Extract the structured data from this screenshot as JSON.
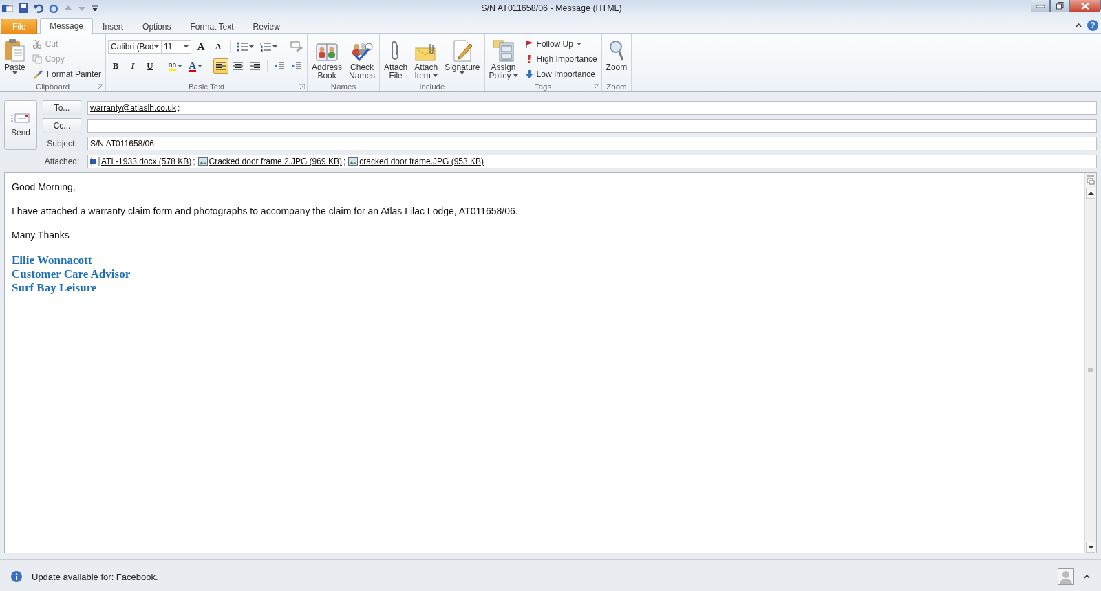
{
  "window": {
    "title": "S/N AT011658/06  -  Message (HTML)",
    "help_glyph": "?"
  },
  "tabs": [
    {
      "kind": "file",
      "label": "File",
      "selected": false
    },
    {
      "kind": "tab",
      "label": "Message",
      "selected": true
    },
    {
      "kind": "tab",
      "label": "Insert",
      "selected": false
    },
    {
      "kind": "tab",
      "label": "Options",
      "selected": false
    },
    {
      "kind": "tab",
      "label": "Format Text",
      "selected": false
    },
    {
      "kind": "tab",
      "label": "Review",
      "selected": false
    }
  ],
  "ribbon": {
    "groups": [
      {
        "kind": "clipboard",
        "label": "Clipboard",
        "launcher": true,
        "paste": {
          "label": "Paste"
        },
        "commands": [
          {
            "label": "Cut",
            "disabled": true
          },
          {
            "label": "Copy",
            "disabled": true
          },
          {
            "label": "Format Painter",
            "disabled": false
          }
        ]
      },
      {
        "kind": "basic_text",
        "label": "Basic Text",
        "launcher": true,
        "font": "Calibri (Bod",
        "size": "11",
        "grow": "A",
        "shrink": "A",
        "styles": [
          {
            "kind": "bold",
            "label": "B"
          },
          {
            "kind": "italic",
            "label": "I"
          },
          {
            "kind": "underline",
            "label": "U"
          }
        ],
        "highlight": "ab",
        "font_color": "A",
        "align": [
          {
            "kind": "left",
            "selected": true
          },
          {
            "kind": "center",
            "selected": false
          },
          {
            "kind": "right",
            "selected": false
          }
        ]
      },
      {
        "kind": "large",
        "label": "Names",
        "launcher": false,
        "buttons": [
          {
            "lines": [
              "Address",
              "Book"
            ],
            "caret": false
          },
          {
            "lines": [
              "Check",
              "Names"
            ],
            "caret": false
          }
        ]
      },
      {
        "kind": "large",
        "label": "Include",
        "launcher": false,
        "buttons": [
          {
            "lines": [
              "Attach",
              "File"
            ],
            "caret": false
          },
          {
            "lines": [
              "Attach",
              "Item"
            ],
            "caret": true
          },
          {
            "lines": [
              "Signature"
            ],
            "caret": true
          }
        ]
      },
      {
        "kind": "tags",
        "label": "Tags",
        "launcher": true,
        "policy": {
          "lines": [
            "Assign",
            "Policy"
          ],
          "caret": true
        },
        "commands": [
          {
            "label": "Follow Up",
            "caret": true
          },
          {
            "label": "High Importance",
            "caret": false
          },
          {
            "label": "Low Importance",
            "caret": false
          }
        ]
      },
      {
        "kind": "large",
        "label": "Zoom",
        "launcher": false,
        "buttons": [
          {
            "lines": [
              "Zoom"
            ],
            "caret": false
          }
        ]
      }
    ]
  },
  "compose": {
    "send": "Send",
    "to": {
      "button": "To...",
      "recipients": [
        "warranty@atlaslh.co.uk"
      ],
      "separator": ";"
    },
    "cc": {
      "button": "Cc..."
    },
    "subject": {
      "label": "Subject:",
      "value": "S/N AT011658/06"
    },
    "attached": {
      "label": "Attached:",
      "separator": ";",
      "files": [
        {
          "kind": "word",
          "name": "ATL-1933.docx (578 KB)"
        },
        {
          "kind": "image",
          "name": "Cracked door frame 2.JPG (969 KB)"
        },
        {
          "kind": "image",
          "name": "cracked door frame.JPG (953 KB)"
        }
      ]
    }
  },
  "body": {
    "paragraphs": [
      "Good Morning,",
      "I have attached a warranty claim form and photographs to accompany the claim for an Atlas Lilac Lodge, AT011658/06.",
      "Many Thanks"
    ],
    "signature": [
      "Ellie Wonnacott",
      "Customer Care Advisor",
      "Surf Bay Leisure"
    ]
  },
  "status_bar": {
    "message": "Update available for: Facebook."
  }
}
